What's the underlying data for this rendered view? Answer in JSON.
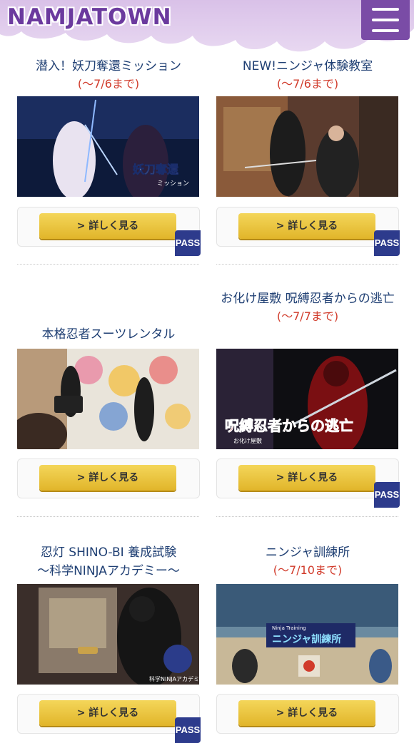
{
  "header": {
    "logo_text": "NAMJATOWN",
    "menu_icon": "hamburger-menu-icon"
  },
  "colors": {
    "brand_purple": "#7a4ca6",
    "title_blue": "#1f3f73",
    "date_red": "#d13b2b",
    "button_gold": "#e1b52a",
    "pass_navy": "#2d3b8c"
  },
  "cards": [
    {
      "title": "潜入！妖刀奪還ミッション",
      "date": "(〜7/6まで)",
      "button": "> 詳しく見る",
      "pass": "PASS"
    },
    {
      "title": "NEW!ニンジャ体験教室",
      "date": "(〜7/6まで)",
      "button": "> 詳しく見る",
      "pass": "PASS"
    },
    {
      "title": "本格忍者スーツレンタル",
      "button": "> 詳しく見る"
    },
    {
      "title": "お化け屋敷 呪縛忍者からの逃亡",
      "date": "(〜7/7まで)",
      "button": "> 詳しく見る",
      "pass": "PASS"
    },
    {
      "title": "忍灯 SHINO-BI 養成試験",
      "subtitle": "〜科学NINJAアカデミー〜",
      "button": "> 詳しく見る",
      "pass": "PASS"
    },
    {
      "title": "ニンジャ訓練所",
      "date": "(〜7/10まで)",
      "button": "> 詳しく見る"
    }
  ],
  "image_text": {
    "card1": "妖刀奪還",
    "card1_sub": "ミッション",
    "card4": "呪縛忍者からの逃亡",
    "card4_sub": "お化け屋敷",
    "card5": "科学NINJAアカデミー",
    "card6": "ニンジャ訓練所",
    "card6_sub": "Ninja Training"
  }
}
